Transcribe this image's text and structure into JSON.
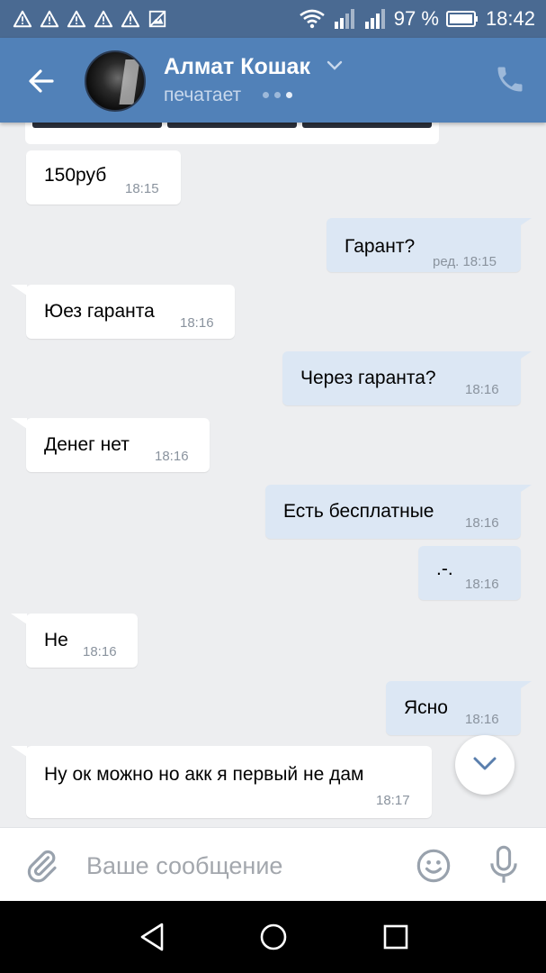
{
  "status_bar": {
    "battery": "97 %",
    "time": "18:42",
    "icons": [
      "warning-icon",
      "warning-icon",
      "warning-icon",
      "warning-icon",
      "warning-icon",
      "image-icon",
      "wifi-icon",
      "signal-icon",
      "signal-icon",
      "battery-icon"
    ]
  },
  "header": {
    "name": "Алмат Кошак",
    "status": "печатает"
  },
  "messages": [
    {
      "dir": "in",
      "text": "150руб",
      "time": "18:15"
    },
    {
      "dir": "out",
      "text": "Гарант?",
      "time": "ред. 18:15"
    },
    {
      "dir": "in",
      "text": "Юез гаранта",
      "time": "18:16"
    },
    {
      "dir": "out",
      "text": "Через гаранта?",
      "time": "18:16"
    },
    {
      "dir": "in",
      "text": "Денег нет",
      "time": "18:16"
    },
    {
      "dir": "out",
      "text": "Есть бесплатные",
      "time": "18:16"
    },
    {
      "dir": "out",
      "text": ".-.",
      "time": "18:16"
    },
    {
      "dir": "in",
      "text": "Не",
      "time": "18:16"
    },
    {
      "dir": "out",
      "text": "Ясно",
      "time": "18:16"
    },
    {
      "dir": "in",
      "text": "Ну ок можно но акк я первый не дам",
      "time": "18:17"
    }
  ],
  "composer": {
    "placeholder": "Ваше сообщение"
  },
  "colors": {
    "header_bg": "#5181b8",
    "statusbar_bg": "#4a6a92",
    "chat_bg": "#edeef0",
    "bubble_in": "#ffffff",
    "bubble_out": "#dce7f4",
    "icon_gray": "#99a2ad"
  }
}
